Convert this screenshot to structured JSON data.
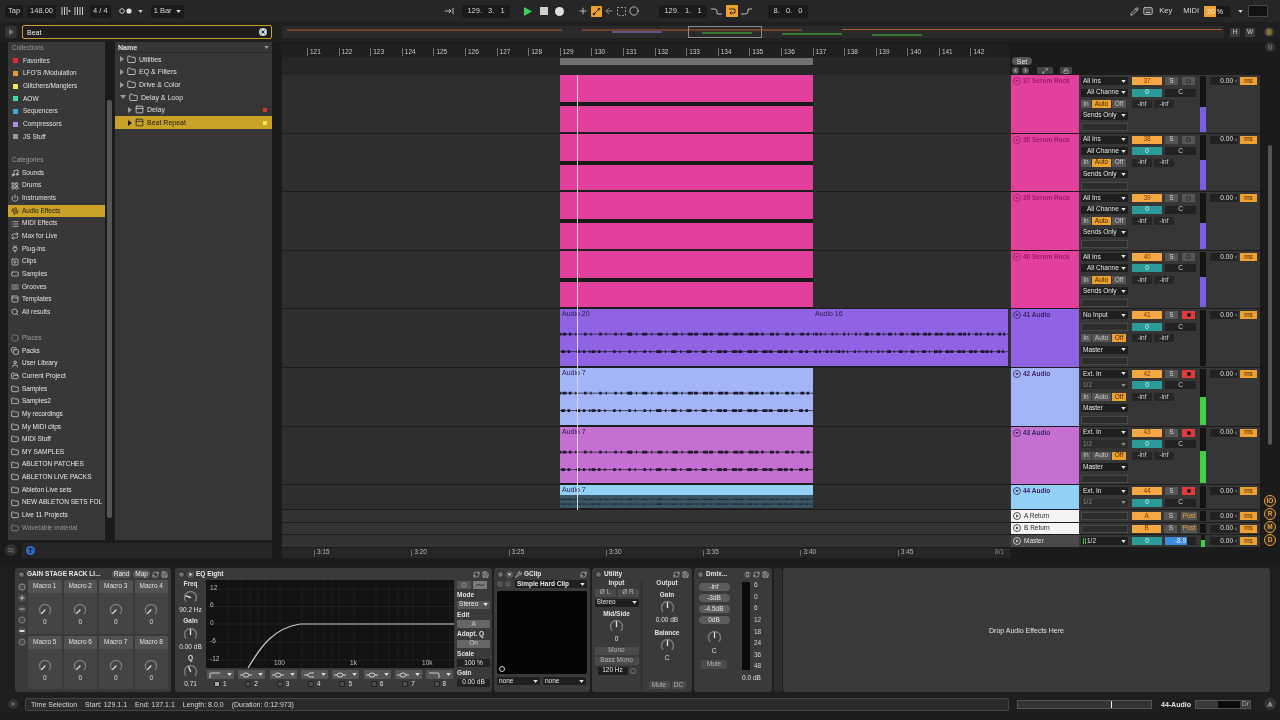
{
  "transport": {
    "tap": "Tap",
    "tempo": "148.00",
    "signature": "4 / 4",
    "quantize": "1 Bar",
    "position": "129. 3. 1",
    "playing": true,
    "loop_start": "129. 1. 1",
    "loop_on": true,
    "loop_length": "8. 0. 0"
  },
  "toolbar_right": {
    "key": "Key",
    "midi": "MIDI",
    "cpu": {
      "text": "20 %",
      "level": 0.45
    }
  },
  "browser": {
    "search": {
      "value": "Beat"
    },
    "collections": {
      "heading": "Collections",
      "items": [
        {
          "label": "Favorites",
          "color": "#e5262e"
        },
        {
          "label": "LFO'S /Modulation",
          "color": "#e89a3a"
        },
        {
          "label": "Glitchers/Manglers",
          "color": "#f2ea4a"
        },
        {
          "label": "AOW",
          "color": "#3fdf9f"
        },
        {
          "label": "Sequencers",
          "color": "#3aa8d8"
        },
        {
          "label": "Compressors",
          "color": "#b08ae6"
        },
        {
          "label": "JS Stuff",
          "color": "#9a9a9a"
        }
      ]
    },
    "categories": {
      "heading": "Categories",
      "items": [
        {
          "label": "Sounds",
          "selected": false
        },
        {
          "label": "Drums",
          "selected": false
        },
        {
          "label": "Instruments",
          "selected": false
        },
        {
          "label": "Audio Effects",
          "selected": true
        },
        {
          "label": "MIDI Effects",
          "selected": false
        },
        {
          "label": "Max for Live",
          "selected": false
        },
        {
          "label": "Plug-ins",
          "selected": false
        },
        {
          "label": "Clips",
          "selected": false
        },
        {
          "label": "Samples",
          "selected": false
        },
        {
          "label": "Grooves",
          "selected": false
        },
        {
          "label": "Templates",
          "selected": false
        },
        {
          "label": "All results",
          "selected": false
        }
      ]
    },
    "places": {
      "heading": "Places",
      "items": [
        {
          "label": "Packs",
          "disabled": false
        },
        {
          "label": "User Library",
          "disabled": false
        },
        {
          "label": "Current Project",
          "disabled": false
        },
        {
          "label": "Samples",
          "disabled": false
        },
        {
          "label": "Samples2",
          "disabled": false
        },
        {
          "label": "My recordings",
          "disabled": false
        },
        {
          "label": "My MIDI clips",
          "disabled": false
        },
        {
          "label": "MIDI Stuff",
          "disabled": false
        },
        {
          "label": "MY SAMPLES",
          "disabled": false
        },
        {
          "label": "ABLETON PATCHES",
          "disabled": false
        },
        {
          "label": "ABLETON LIVE PACKS",
          "disabled": false
        },
        {
          "label": "Ableton Live sets",
          "disabled": false
        },
        {
          "label": "NEW ABLETON SETS FOL",
          "disabled": false
        },
        {
          "label": "Live 11 Projects",
          "disabled": false
        },
        {
          "label": "Wavetable material",
          "disabled": true
        }
      ]
    },
    "name_header": "Name",
    "tree": [
      {
        "label": "Utilities",
        "kind": "folder",
        "expanded": false,
        "selected": false
      },
      {
        "label": "EQ & Filters",
        "kind": "folder",
        "expanded": false,
        "selected": false
      },
      {
        "label": "Drive & Color",
        "kind": "folder",
        "expanded": false,
        "selected": false
      },
      {
        "label": "Delay & Loop",
        "kind": "folder",
        "expanded": true,
        "selected": false,
        "children": [
          {
            "label": "Delay",
            "kind": "device",
            "expanded": false,
            "selected": false,
            "color": "#e0302a"
          },
          {
            "label": "Beat Repeat",
            "kind": "device",
            "expanded": false,
            "selected": true,
            "color": "#f2e84a"
          }
        ]
      }
    ]
  },
  "overview": {
    "buttons": [
      "H",
      "W"
    ]
  },
  "arrangement": {
    "ruler": [
      "121",
      "122",
      "123",
      "124",
      "125",
      "126",
      "127",
      "128",
      "129",
      "130",
      "131",
      "132",
      "133",
      "134",
      "135",
      "136",
      "137",
      "138",
      "139",
      "140",
      "141",
      "142"
    ],
    "set": "Set",
    "tracks": [
      {
        "name": "37 Serum Rack",
        "kind": "midi",
        "color": "#e33f9d",
        "clips": [
          {
            "kind": "midi"
          }
        ],
        "input": "All Ins",
        "channel": "All Channe",
        "channel_disabled": false,
        "monitor": [
          {
            "label": "In",
            "selected": false
          },
          {
            "label": "Auto",
            "selected": true
          },
          {
            "label": "Off",
            "selected": false
          }
        ],
        "output": "Sends Only",
        "number": "37",
        "solo": "S",
        "armed": false,
        "volume": "0",
        "pan": "C",
        "sends": [
          "-inf",
          "-inf"
        ],
        "level": 0.45,
        "delay": "0.00",
        "unit": "ms"
      },
      {
        "name": "38 Serum Rack",
        "kind": "midi",
        "color": "#e33f9d",
        "clips": [
          {
            "kind": "midi"
          }
        ],
        "input": "All Ins",
        "channel": "All Channe",
        "channel_disabled": false,
        "monitor": [
          {
            "label": "In",
            "selected": false
          },
          {
            "label": "Auto",
            "selected": true
          },
          {
            "label": "Off",
            "selected": false
          }
        ],
        "output": "Sends Only",
        "number": "38",
        "solo": "S",
        "armed": false,
        "volume": "0",
        "pan": "C",
        "sends": [
          "-inf",
          "-inf"
        ],
        "level": 0.55,
        "delay": "0.00",
        "unit": "ms"
      },
      {
        "name": "39 Serum Rack",
        "kind": "midi",
        "color": "#e33f9d",
        "clips": [
          {
            "kind": "midi"
          }
        ],
        "input": "All Ins",
        "channel": "All Channe",
        "channel_disabled": false,
        "monitor": [
          {
            "label": "In",
            "selected": false
          },
          {
            "label": "Auto",
            "selected": true
          },
          {
            "label": "Off",
            "selected": false
          }
        ],
        "output": "Sends Only",
        "number": "39",
        "solo": "S",
        "armed": false,
        "volume": "0",
        "pan": "C",
        "sends": [
          "-inf",
          "-inf"
        ],
        "level": 0.47,
        "delay": "0.00",
        "unit": "ms"
      },
      {
        "name": "40 Serum Rack",
        "kind": "midi",
        "color": "#e33f9d",
        "clips": [
          {
            "kind": "midi"
          }
        ],
        "input": "All Ins",
        "channel": "All Channe",
        "channel_disabled": false,
        "monitor": [
          {
            "label": "In",
            "selected": false
          },
          {
            "label": "Auto",
            "selected": true
          },
          {
            "label": "Off",
            "selected": false
          }
        ],
        "output": "Sends Only",
        "number": "40",
        "solo": "S",
        "armed": false,
        "volume": "0",
        "pan": "C",
        "sends": [
          "-inf",
          "-inf"
        ],
        "level": 0.55,
        "delay": "0.00",
        "unit": "ms"
      },
      {
        "name": "41 Audio",
        "kind": "audio",
        "color": "#8f63e3",
        "clips": [
          {
            "kind": "audio",
            "name": "Audio 20"
          },
          {
            "kind": "audio",
            "name": "Audio 16"
          }
        ],
        "input": "No Input",
        "monitor": [
          {
            "label": "In",
            "selected": false
          },
          {
            "label": "Auto",
            "selected": false
          },
          {
            "label": "Off",
            "selected": true
          }
        ],
        "output": "Master",
        "number": "41",
        "solo": "S",
        "armed": true,
        "volume": "0",
        "pan": "C",
        "sends": [
          "-inf",
          "-inf"
        ],
        "delay": "0.00",
        "unit": "ms"
      },
      {
        "name": "42 Audio",
        "kind": "audio",
        "color": "#a3b5f7",
        "clips": [
          {
            "kind": "audio",
            "name": "Audio 7"
          }
        ],
        "input": "Ext. In",
        "channel": "1/2",
        "channel_disabled": true,
        "monitor": [
          {
            "label": "In",
            "selected": false
          },
          {
            "label": "Auto",
            "selected": false
          },
          {
            "label": "Off",
            "selected": true
          }
        ],
        "output": "Master",
        "number": "42",
        "solo": "S",
        "armed": true,
        "volume": "0",
        "pan": "C",
        "sends": [
          "-inf",
          "-inf"
        ],
        "level": 0.5,
        "delay": "0.00",
        "unit": "ms"
      },
      {
        "name": "43 Audio",
        "kind": "audio",
        "color": "#c46fd1",
        "clips": [
          {
            "kind": "audio",
            "name": "Audio 7"
          }
        ],
        "input": "Ext. In",
        "channel": "1/2",
        "channel_disabled": true,
        "monitor": [
          {
            "label": "In",
            "selected": false
          },
          {
            "label": "Auto",
            "selected": false
          },
          {
            "label": "Off",
            "selected": true
          }
        ],
        "output": "Master",
        "number": "43",
        "solo": "S",
        "armed": true,
        "volume": "0",
        "pan": "C",
        "sends": [
          "-inf",
          "-inf"
        ],
        "level": 0.58,
        "delay": "0.00",
        "unit": "ms"
      },
      {
        "name": "44 Audio",
        "kind": "audio",
        "color": "#93d0f5",
        "clips": [
          {
            "kind": "audio",
            "name": "Audio 7"
          }
        ],
        "input": "Ext. In",
        "channel": "1/2",
        "channel_disabled": true,
        "number": "44",
        "solo": "S",
        "armed": true,
        "volume": "0",
        "pan": "C",
        "delay": "0.00",
        "unit": "ms"
      }
    ],
    "returns": [
      {
        "name": "A Return",
        "letter": "A",
        "solo": "S",
        "post": "Post",
        "delay": "0.00",
        "unit": "ms"
      },
      {
        "name": "B Return",
        "letter": "B",
        "solo": "S",
        "post": "Post",
        "delay": "0.00",
        "unit": "ms"
      }
    ],
    "master": {
      "name": "Master",
      "output": "1/2",
      "volume": "0",
      "cue": {
        "text": "-8.9",
        "level": 0.72
      },
      "meter": {
        "level": 0.6
      },
      "delay": "0.00",
      "unit": "ms"
    },
    "time_ruler": [
      "3:15",
      "3:20",
      "3:25",
      "3:30",
      "3:35",
      "3:40",
      "3:45"
    ],
    "grid": "8/1"
  },
  "mixer_sections": [
    "IO",
    "R",
    "M",
    "D"
  ],
  "devices": {
    "rack": {
      "title": "GAIN STAGE RACK LI...",
      "buttons": [
        "Rand",
        "Map"
      ],
      "macros": [
        {
          "label": "Macro 1",
          "value": "0"
        },
        {
          "label": "Macro 2",
          "value": "0"
        },
        {
          "label": "Macro 3",
          "value": "0"
        },
        {
          "label": "Macro 4",
          "value": "0"
        },
        {
          "label": "Macro 5",
          "value": "0"
        },
        {
          "label": "Macro 6",
          "value": "0"
        },
        {
          "label": "Macro 7",
          "value": "0"
        },
        {
          "label": "Macro 8",
          "value": "0"
        }
      ]
    },
    "eq": {
      "title": "EQ Eight",
      "freq_label": "Freq",
      "freq": "90.2 Hz",
      "gain_label": "Gain",
      "gain": "0.00 dB",
      "q_label": "Q",
      "q": "0.71",
      "y_labels": [
        "12",
        "6",
        "0",
        "-6",
        "-12"
      ],
      "x_labels": [
        "100",
        "1k",
        "10k"
      ],
      "bands": [
        {
          "number": "1",
          "kind": "highpass",
          "on": true
        },
        {
          "number": "2",
          "kind": "bell",
          "on": false
        },
        {
          "number": "3",
          "kind": "bell",
          "on": false
        },
        {
          "number": "4",
          "kind": "lowshelf",
          "on": false
        },
        {
          "number": "5",
          "kind": "bell",
          "on": false
        },
        {
          "number": "6",
          "kind": "bell",
          "on": false
        },
        {
          "number": "7",
          "kind": "bell",
          "on": false
        },
        {
          "number": "8",
          "kind": "lowpass",
          "on": false
        }
      ],
      "settings": [
        {
          "label": "Mode",
          "value": "Stereo",
          "kind": "dropdown"
        },
        {
          "label": "Edit",
          "value": "A",
          "kind": "button"
        },
        {
          "label": "Adapt. Q",
          "value": "On",
          "kind": "button"
        },
        {
          "label": "Scale",
          "value": "100 %",
          "kind": "field"
        },
        {
          "label": "Gain",
          "value": "0.00 dB",
          "kind": "field"
        }
      ]
    },
    "gclip": {
      "title": "GClip",
      "preset": "Simple Hard Clip",
      "selectors": [
        "none",
        "none"
      ]
    },
    "utility": {
      "title": "Utility",
      "input": {
        "label": "Input",
        "phase": [
          "Ø L",
          "Ø R"
        ],
        "mode": "Stereo",
        "midside_label": "Mid/Side",
        "midside": "0",
        "mono": "Mono",
        "bass_mono": "Bass Mono",
        "bass_freq": "120 Hz"
      },
      "output": {
        "label": "Output",
        "gain_label": "Gain",
        "gain": "0.00 dB",
        "balance_label": "Balance",
        "balance": "C",
        "mute": "Mute",
        "dc": "DC"
      }
    },
    "dmix": {
      "title": "Dmix...",
      "presets": [
        "-inf",
        "-3dB",
        "-4.5dB",
        "0dB"
      ],
      "knob": "C",
      "mute": "Mute",
      "scale": [
        "6",
        "0",
        "6",
        "12",
        "18",
        "24",
        "36",
        "48"
      ],
      "readout": "0.0 dB"
    },
    "drop_hint": "Drop Audio Effects Here"
  },
  "status_bar": {
    "label": "Time Selection",
    "start": "Start: 129.1.1",
    "end": "End: 137.1.1",
    "length": "Length: 8.0.0",
    "duration": "(Duration: 0:12:973)",
    "track": "44-Audio",
    "fragment": "Dr"
  }
}
